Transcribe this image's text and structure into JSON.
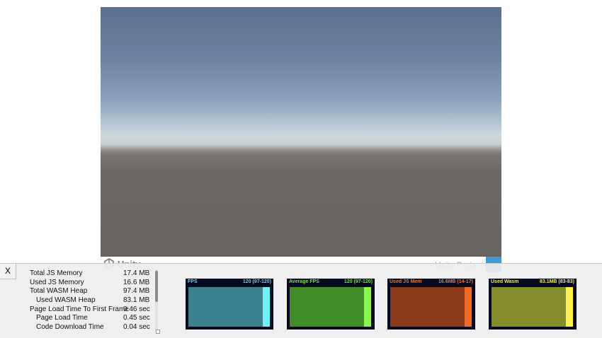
{
  "footer": {
    "logo_text": "Unity",
    "project_name": "Unity Project"
  },
  "overlay": {
    "close_label": "X",
    "stats": [
      {
        "label": "Total JS Memory",
        "value": "17.4 MB",
        "indent": false
      },
      {
        "label": "Used JS Memory",
        "value": "16.6 MB",
        "indent": false
      },
      {
        "label": "Total WASM Heap",
        "value": "97.4 MB",
        "indent": false
      },
      {
        "label": "Used WASM Heap",
        "value": "83.1 MB",
        "indent": true
      },
      {
        "label": "Page Load Time To First Frame",
        "value": "0.46 sec",
        "indent": false
      },
      {
        "label": "Page Load Time",
        "value": "0.45 sec",
        "indent": true
      },
      {
        "label": "Code Download Time",
        "value": "0.04 sec",
        "indent": true
      }
    ],
    "graphs": [
      {
        "title": "FPS",
        "range": "120 (97-120)",
        "text_color": "#5fd3f5",
        "fill_color": "#3b8290",
        "bar_color": "#6ff0f5"
      },
      {
        "title": "Average FPS",
        "range": "120 (97-120)",
        "text_color": "#7be04b",
        "fill_color": "#418d27",
        "bar_color": "#8af74f"
      },
      {
        "title": "Used JS Mem",
        "range": "16.6MB (14-17)",
        "text_color": "#f07a36",
        "fill_color": "#8a3a18",
        "bar_color": "#f06a26"
      },
      {
        "title": "Used Wasm",
        "range": "83.1MB (83-83)",
        "text_color": "#f4f23c",
        "fill_color": "#858c2a",
        "bar_color": "#fff04a"
      }
    ]
  }
}
